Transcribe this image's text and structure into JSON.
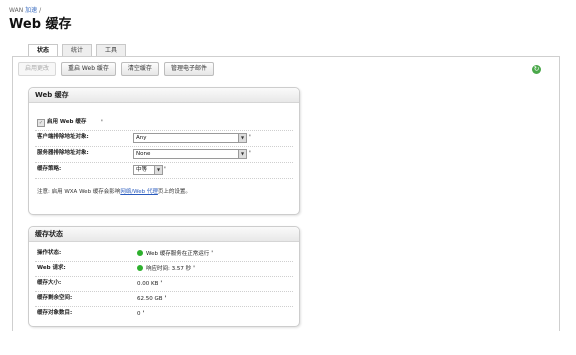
{
  "breadcrumb": {
    "root": "WAN",
    "link": "加速",
    "sep": "/"
  },
  "page_title": "Web 缓存",
  "tabs": [
    {
      "label": "状态",
      "active": true
    },
    {
      "label": "统计"
    },
    {
      "label": "工具"
    }
  ],
  "actions": [
    {
      "label": "启用更改",
      "disabled": true
    },
    {
      "label": "重启 Web 缓存"
    },
    {
      "label": "清空缓存"
    },
    {
      "label": "管理电子邮件"
    }
  ],
  "settings_panel": {
    "title": "Web 缓存",
    "enable_label": "启用 Web 缓存",
    "enabled": true,
    "client_exclude_label": "客户端排除地址对象:",
    "client_exclude_value": "Any",
    "server_exclude_label": "服务器排除地址对象:",
    "server_exclude_value": "None",
    "cache_level_label": "缓存策略:",
    "cache_level_value": "中等",
    "help_marker": "'",
    "note_prefix": "注意: 启用 WXA Web 缓存会影响",
    "note_link": "网络/Web 代理",
    "note_suffix": "页上的设置。"
  },
  "status_panel": {
    "title": "缓存状态",
    "rows": [
      {
        "label": "操作状态:",
        "value": "Web 缓存服务在正常运行",
        "dot": true
      },
      {
        "label": "Web 请求:",
        "value": "响应时间: 3.57 秒",
        "dot": true
      },
      {
        "label": "缓存大小:",
        "value": "0.00 KB"
      },
      {
        "label": "缓存剩余空间:",
        "value": "62.50 GB"
      },
      {
        "label": "缓存对象数目:",
        "value": "0"
      }
    ]
  },
  "colors": {
    "status_ok": "#2db02d",
    "link": "#2a5bbd"
  },
  "icons": {
    "refresh": "refresh-icon",
    "help": "help-icon",
    "dropdown": "chevron-down-icon"
  }
}
